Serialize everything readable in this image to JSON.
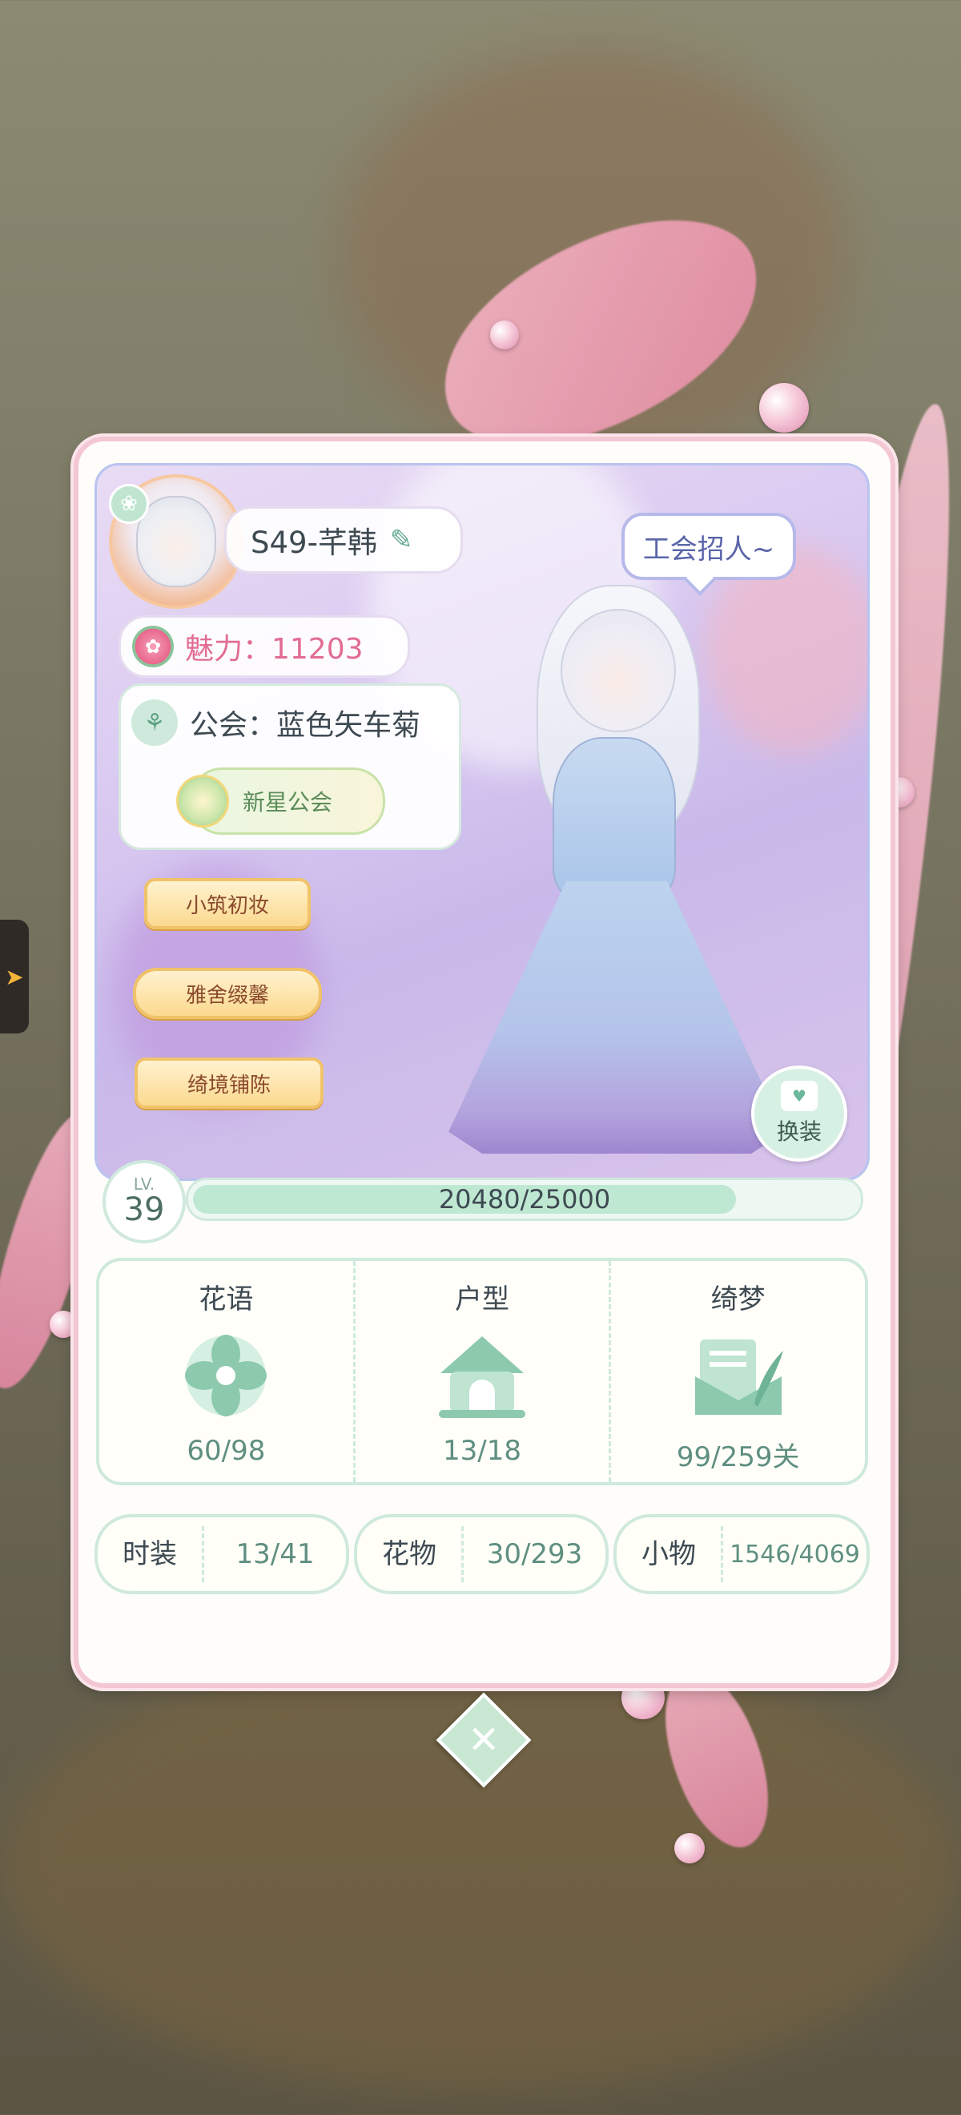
{
  "profile": {
    "name": "S49-芊韩",
    "charm_label": "魅力：11203",
    "guild_label": "公会：蓝色矢车菊",
    "guild_badge": "新星公会",
    "recruit_bubble": "工会招人~",
    "change_outfit": "换装",
    "titles": [
      "小筑初妆",
      "雅舍缀馨",
      "绮境铺陈"
    ]
  },
  "level": {
    "lv_label": "LV.",
    "value": "39",
    "xp_text": "20480/25000",
    "xp_current": 20480,
    "xp_max": 25000
  },
  "stats": [
    {
      "label": "花语",
      "value": "60/98",
      "icon": "flower-icon"
    },
    {
      "label": "户型",
      "value": "13/18",
      "icon": "house-icon"
    },
    {
      "label": "绮梦",
      "value": "99/259关",
      "icon": "letter-quill-icon"
    }
  ],
  "collections": [
    {
      "label": "时装",
      "value": "13/41"
    },
    {
      "label": "花物",
      "value": "30/293"
    },
    {
      "label": "小物",
      "value": "1546/4069"
    }
  ],
  "colors": {
    "card_border": "#f3c7d3",
    "accent_green": "#cfe9dc",
    "charm_pink": "#e26c93"
  }
}
